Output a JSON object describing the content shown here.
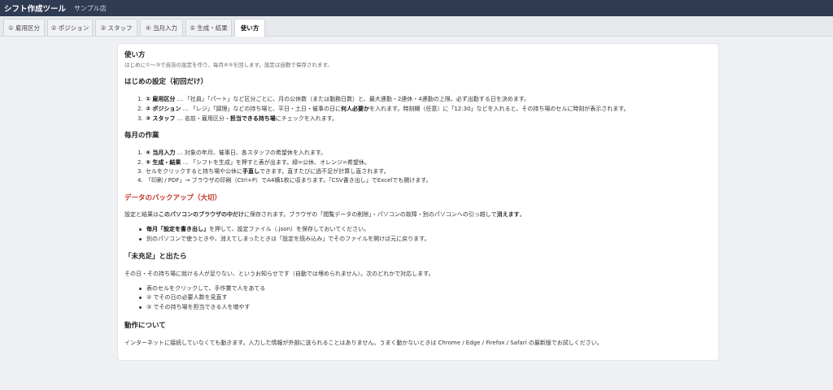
{
  "header": {
    "app_title": "シフト作成ツール",
    "store_name": "サンプル店"
  },
  "tabs": [
    {
      "label": "① 雇用区分"
    },
    {
      "label": "② ポジション"
    },
    {
      "label": "③ スタッフ"
    },
    {
      "label": "④ 当月入力"
    },
    {
      "label": "⑤ 生成・結果"
    },
    {
      "label": "使い方"
    }
  ],
  "help": {
    "title": "使い方",
    "subtitle": "はじめに①〜③で自店の設定を作り、毎月④⑤を回します。設定は自動で保存されます。",
    "setup": {
      "heading": "はじめの設定（初回だけ）",
      "items": [
        {
          "num": "1.",
          "name": "① 雇用区分",
          "pre": " … 「社員」「パート」など区分ごとに、月の公休数（または勤務日数）と、最大連勤・2連休・4連勤の上限、必ず出勤する日を決めます。"
        },
        {
          "num": "2.",
          "name": "② ポジション",
          "pre": " … 「レジ」「調理」などの持ち場と、平日・土日・催事の日に",
          "bold2": "何人必要か",
          "post": "を入れます。時刻欄（任意）に「12:30」などを入れると、その持ち場のセルに時刻が表示されます。"
        },
        {
          "num": "3.",
          "name": "③ スタッフ",
          "pre": " … 名前・雇用区分・",
          "bold2": "担当できる持ち場",
          "post": "にチェックを入れます。"
        }
      ]
    },
    "monthly": {
      "heading": "毎月の作業",
      "items": [
        {
          "num": "1.",
          "name": "④ 当月入力",
          "pre": " … 対象の年月、催事日、各スタッフの希望休を入れます。"
        },
        {
          "num": "2.",
          "name": "⑤ 生成・結果",
          "pre": " … 「シフトを生成」を押すと表が出ます。緑=公休、オレンジ=希望休。"
        },
        {
          "num": "3.",
          "pre": "セルをクリックすると持ち場や公休に",
          "bold2": "手直し",
          "post": "できます。直すたびに過不足が計算し直されます。"
        },
        {
          "num": "4.",
          "pre": "「印刷 / PDF」→ ブラウザの印刷（Ctrl+P）でA4横1枚に収まります。「CSV書き出し」でExcelでも開けます。"
        }
      ]
    },
    "backup": {
      "heading": "データのバックアップ（大切）",
      "text_pre": "設定と結果は",
      "text_bold": "このパソコンのブラウザの中だけ",
      "text_mid": "に保存されます。ブラウザの「閲覧データの削除」・パソコンの故障・別のパソコンへの引っ越しで",
      "text_bold2": "消えます",
      "text_end": "。",
      "items": [
        {
          "bold": "毎月「設定を書き出し」",
          "rest": "を押して、設定ファイル（.json）を保存しておいてください。"
        },
        {
          "rest": "別のパソコンで使うときや、消えてしまったときは「設定を読み込み」でそのファイルを開けば元に戻ります。"
        }
      ]
    },
    "shortage": {
      "heading": "「未充足」と出たら",
      "text": "その日・その持ち場に就ける人が足りない、というお知らせです（自動では埋められません）。次のどれかで対応します。",
      "items": [
        "表のセルをクリックして、手作業で人をあてる",
        "② でその日の必要人数を見直す",
        "③ でその持ち場を担当できる人を増やす"
      ]
    },
    "about": {
      "heading": "動作について",
      "text": "インターネットに接続していなくても動きます。入力した情報が外部に送られることはありません。うまく動かないときは Chrome / Edge / Firefox / Safari の最新版でお試しください。"
    }
  }
}
